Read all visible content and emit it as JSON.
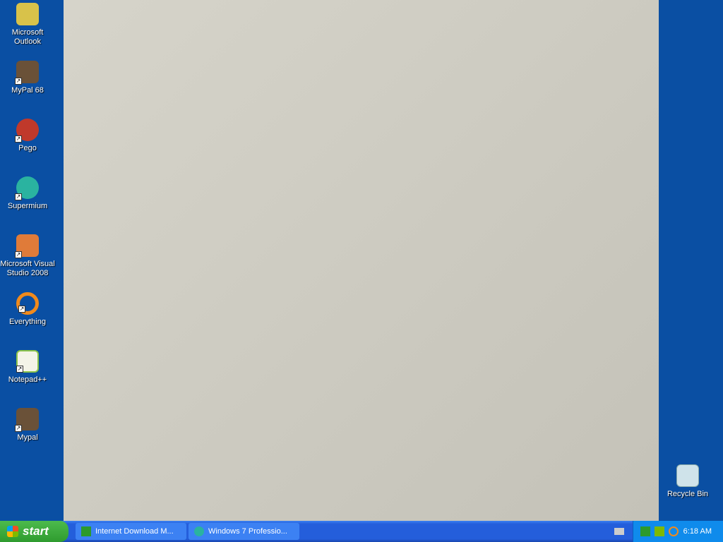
{
  "desktop_icons": [
    {
      "label": "Microsoft Outlook",
      "icon": "outlook-icon",
      "color": "#d8c24a"
    },
    {
      "label": "MyPal 68",
      "icon": "mypal-icon",
      "color": "#6a5138"
    },
    {
      "label": "Pego",
      "icon": "pego-icon",
      "color": "#c0392b"
    },
    {
      "label": "Supermium",
      "icon": "supermium-icon",
      "color": "#2ab3a0"
    },
    {
      "label": "Microsoft Visual Studio 2008",
      "icon": "visual-studio-icon",
      "color": "#e07b39"
    },
    {
      "label": "Everything",
      "icon": "everything-icon",
      "color": "#f08a1c"
    },
    {
      "label": "Notepad++",
      "icon": "notepadpp-icon",
      "color": "#8bc34a"
    },
    {
      "label": "Mypal",
      "icon": "mypal-icon",
      "color": "#6a5138"
    }
  ],
  "recycle_bin": {
    "label": "Recycle Bin",
    "icon": "recycle-bin-icon"
  },
  "taskbar": {
    "start_label": "start",
    "tasks": [
      {
        "label": "Internet Download M...",
        "icon": "idm-icon"
      },
      {
        "label": "Windows 7 Professio...",
        "icon": "supermium-icon"
      }
    ],
    "clock": "6:18 AM"
  }
}
